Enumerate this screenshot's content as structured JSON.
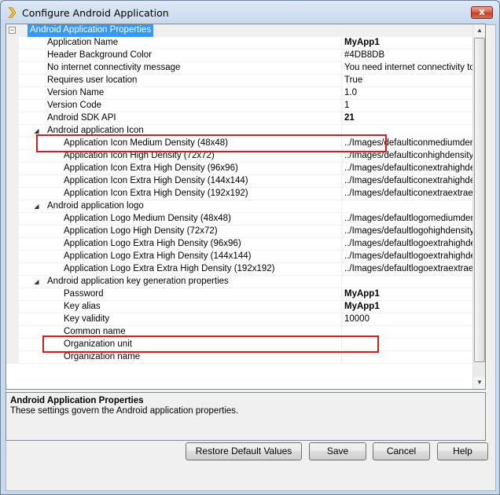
{
  "window": {
    "title": "Configure Android Application",
    "close_label": "x",
    "app_icon": "chevron-arrow-icon"
  },
  "grid": {
    "rows": [
      {
        "kind": "category",
        "name": "Android Application Properties",
        "value": "",
        "selected": true,
        "toggle": "minus-box"
      },
      {
        "kind": "prop",
        "level": 1,
        "name": "Application Name",
        "value": "MyApp1",
        "bold": true
      },
      {
        "kind": "prop",
        "level": 1,
        "name": "Header Background Color",
        "value": "#4DB8DB"
      },
      {
        "kind": "prop",
        "level": 1,
        "name": "No internet connectivity message",
        "value": "You need internet connectivity to ac"
      },
      {
        "kind": "prop",
        "level": 1,
        "name": "Requires user location",
        "value": "True"
      },
      {
        "kind": "prop",
        "level": 1,
        "name": "Version Name",
        "value": "1.0"
      },
      {
        "kind": "prop",
        "level": 1,
        "name": "Version Code",
        "value": "1"
      },
      {
        "kind": "prop",
        "level": 1,
        "name": "Android SDK API",
        "value": "21",
        "bold": true
      },
      {
        "kind": "group",
        "level": 1,
        "name": "Android application Icon",
        "value": ""
      },
      {
        "kind": "prop",
        "level": 2,
        "name": "Application Icon Medium Density (48x48)",
        "value": "../Images/defaulticonmediumdensity"
      },
      {
        "kind": "prop",
        "level": 2,
        "name": "Application Icon High Density (72x72)",
        "value": "../Images/defaulticonhighdensity.png"
      },
      {
        "kind": "prop",
        "level": 2,
        "name": "Application Icon Extra High Density (96x96)",
        "value": "../Images/defaulticonextrahighdensit"
      },
      {
        "kind": "prop",
        "level": 2,
        "name": "Application Icon Extra High Density (144x144)",
        "value": "../Images/defaulticonextrahighden"
      },
      {
        "kind": "prop",
        "level": 2,
        "name": "Application Icon Extra High Density (192x192)",
        "value": "../Images/defaulticonextraextraextra"
      },
      {
        "kind": "group",
        "level": 1,
        "name": "Android application logo",
        "value": ""
      },
      {
        "kind": "prop",
        "level": 2,
        "name": "Application Logo Medium Density (48x48)",
        "value": "../Images/defaultlogomediumdensity"
      },
      {
        "kind": "prop",
        "level": 2,
        "name": "Application Logo High Density (72x72)",
        "value": "../Images/defaultlogohighdensity.png"
      },
      {
        "kind": "prop",
        "level": 2,
        "name": "Application Logo Extra High Density (96x96)",
        "value": "../Images/defaultlogoextrahighdensit"
      },
      {
        "kind": "prop",
        "level": 2,
        "name": "Application Logo Extra High Density (144x144)",
        "value": "../Images/defaultlogoextrahighden"
      },
      {
        "kind": "prop",
        "level": 2,
        "name": "Application Logo Extra Extra High Density (192x192)",
        "value": "../Images/defaultlogoextraextraextra"
      },
      {
        "kind": "group",
        "level": 1,
        "name": "Android application key generation properties",
        "value": ""
      },
      {
        "kind": "prop",
        "level": 2,
        "name": "Password",
        "value": "MyApp1",
        "bold": true
      },
      {
        "kind": "prop",
        "level": 2,
        "name": "Key alias",
        "value": "MyApp1",
        "bold": true
      },
      {
        "kind": "prop",
        "level": 2,
        "name": "Key validity",
        "value": "10000"
      },
      {
        "kind": "prop",
        "level": 2,
        "name": "Common name",
        "value": ""
      },
      {
        "kind": "prop",
        "level": 2,
        "name": "Organization unit",
        "value": ""
      },
      {
        "kind": "prop",
        "level": 2,
        "name": "Organization name",
        "value": ""
      }
    ]
  },
  "help": {
    "title": "Android Application Properties",
    "description": "These settings govern the Android application properties."
  },
  "buttons": {
    "restore": "Restore Default Values",
    "save": "Save",
    "cancel": "Cancel",
    "help": "Help"
  },
  "colors": {
    "selection": "#3399ff",
    "highlight_box": "#d71920"
  }
}
